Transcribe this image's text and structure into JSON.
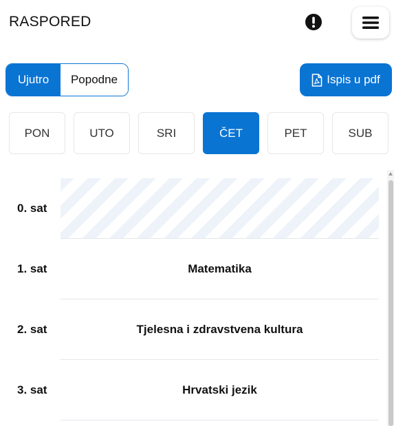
{
  "header": {
    "title": "RASPORED",
    "alert_icon": "exclamation-circle-icon",
    "menu_icon": "hamburger-menu-icon"
  },
  "shift": {
    "options": [
      "Ujutro",
      "Popodne"
    ],
    "selected": "Ujutro"
  },
  "pdf_button": {
    "label": "Ispis u pdf",
    "icon": "pdf-file-icon"
  },
  "days": [
    "PON",
    "UTO",
    "SRI",
    "ČET",
    "PET",
    "SUB"
  ],
  "selected_day": "ČET",
  "schedule": [
    {
      "slot": "0. sat",
      "subject": ""
    },
    {
      "slot": "1. sat",
      "subject": "Matematika"
    },
    {
      "slot": "2. sat",
      "subject": "Tjelesna i zdravstvena kultura"
    },
    {
      "slot": "3. sat",
      "subject": "Hrvatski jezik"
    }
  ],
  "colors": {
    "accent": "#0a74d3",
    "empty_stripe": "#eef3fa",
    "border": "#e6e6e6"
  }
}
